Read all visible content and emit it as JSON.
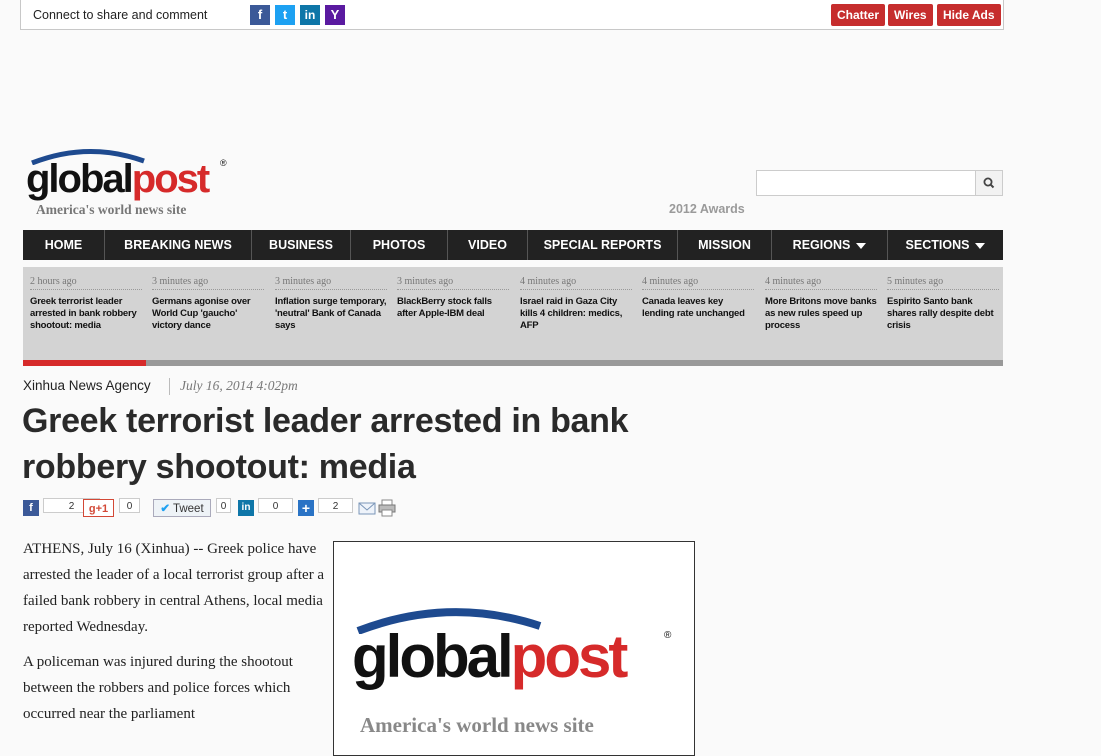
{
  "topbar": {
    "connect_text": "Connect to share and comment",
    "social": [
      {
        "icon": "facebook-icon",
        "glyph": "f",
        "color": "#3b5998"
      },
      {
        "icon": "twitter-icon",
        "glyph": "t",
        "color": "#1da1f2"
      },
      {
        "icon": "linkedin-icon",
        "glyph": "in",
        "color": "#0e76a8"
      },
      {
        "icon": "yahoo-icon",
        "glyph": "Y",
        "color": "#5a1aa0"
      }
    ],
    "buttons": {
      "chatter": "Chatter",
      "wires": "Wires",
      "hide_ads": "Hide Ads"
    },
    "accent_color": "#c62d2d"
  },
  "header": {
    "logo": {
      "part1": "global",
      "part2": "post",
      "reg": "®",
      "tagline": "America's world news site"
    },
    "search": {
      "placeholder": "",
      "value": ""
    },
    "awards": "2012 Awards"
  },
  "nav": {
    "items": [
      {
        "label": "HOME"
      },
      {
        "label": "BREAKING NEWS"
      },
      {
        "label": "BUSINESS"
      },
      {
        "label": "PHOTOS"
      },
      {
        "label": "VIDEO"
      },
      {
        "label": "SPECIAL REPORTS"
      },
      {
        "label": "MISSION"
      },
      {
        "label": "REGIONS"
      },
      {
        "label": "SECTIONS"
      }
    ]
  },
  "ticker": {
    "items": [
      {
        "time": "2 hours ago",
        "headline": "Greek terrorist leader arrested in bank robbery shootout: media"
      },
      {
        "time": "3 minutes ago",
        "headline": "Germans agonise over World Cup 'gaucho' victory dance"
      },
      {
        "time": "3 minutes ago",
        "headline": "Inflation surge temporary, 'neutral' Bank of Canada says"
      },
      {
        "time": "3 minutes ago",
        "headline": "BlackBerry stock falls after Apple-IBM deal"
      },
      {
        "time": "4 minutes ago",
        "headline": "Israel raid in Gaza City kills 4 children: medics, AFP"
      },
      {
        "time": "4 minutes ago",
        "headline": "Canada leaves key lending rate unchanged"
      },
      {
        "time": "4 minutes ago",
        "headline": "More Britons move banks as new rules speed up process"
      },
      {
        "time": "5 minutes ago",
        "headline": "Espirito Santo bank shares rally despite debt crisis"
      }
    ],
    "progress": 0.125
  },
  "article": {
    "source": "Xinhua News Agency",
    "date": "July 16, 2014 4:02pm",
    "title": "Greek terrorist leader arrested in bank robbery shootout: media",
    "shares": {
      "facebook": "2",
      "gplus_label": "+1",
      "gplus": "0",
      "tweet_label": "Tweet",
      "twitter": "0",
      "linkedin": "0",
      "addthis": "2"
    },
    "paragraphs": [
      "ATHENS, July 16 (Xinhua) -- Greek police have arrested the leader of a local terrorist group after a failed bank robbery in central Athens, local media reported Wednesday.",
      "A policeman was injured during the shootout between the robbers and police forces which occurred near the parliament"
    ],
    "figure": {
      "part1": "global",
      "part2": "post",
      "reg": "®",
      "tagline": "America's world news site"
    }
  }
}
